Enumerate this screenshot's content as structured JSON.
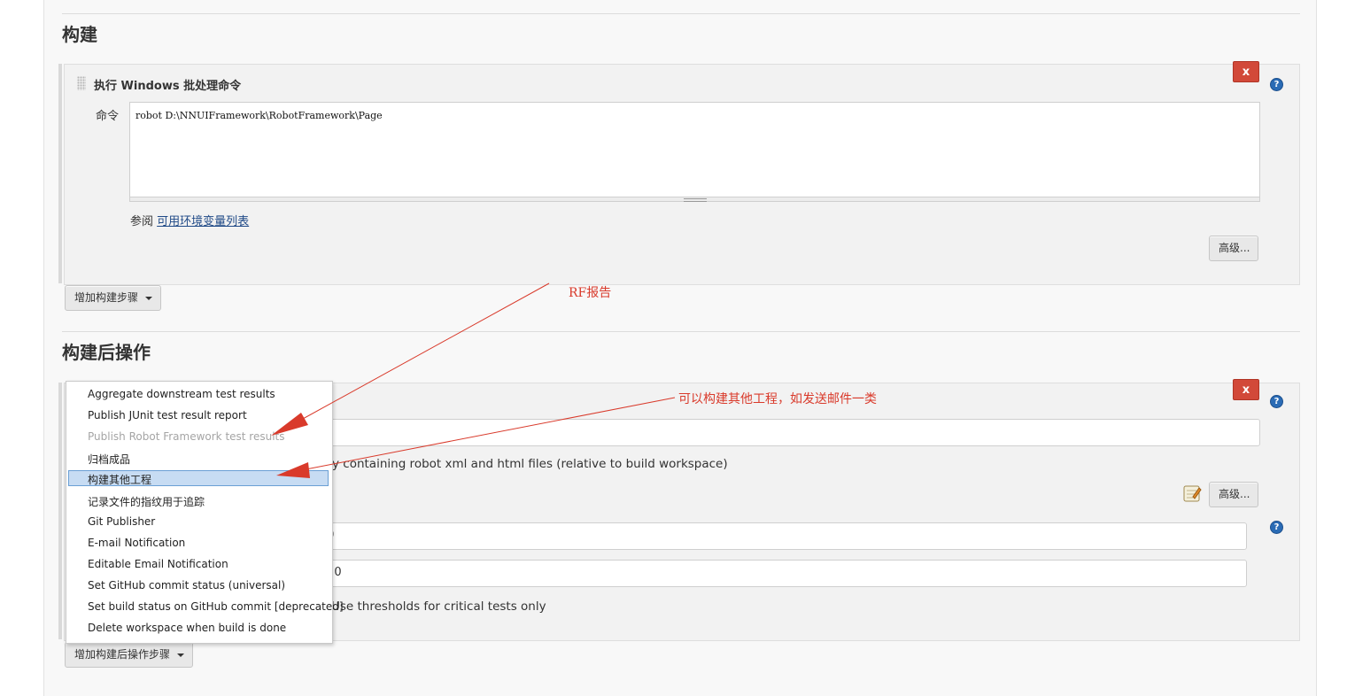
{
  "build": {
    "title": "构建",
    "step_title": "执行 Windows 批处理命令",
    "delete_label": "x",
    "command_label": "命令",
    "command_value": "robot D:\\NNUIFramework\\RobotFramework\\Page",
    "see_label": "参阅",
    "env_link": "可用环境变量列表",
    "advanced_label": "高级...",
    "add_step_label": "增加构建步骤"
  },
  "post_build": {
    "title": "构建后操作",
    "delete_label": "x",
    "dir_hint": "y containing robot xml and html files (relative to build workspace)",
    "advanced_label": "高级...",
    "threshold_1": ".0",
    "threshold_2": "0.0",
    "critical_label": "Use thresholds for critical tests only",
    "add_step_label": "增加构建后操作步骤"
  },
  "dropdown": {
    "items": [
      {
        "label": "Aggregate downstream test results",
        "state": "normal"
      },
      {
        "label": "Publish JUnit test result report",
        "state": "normal"
      },
      {
        "label": "Publish Robot Framework test results",
        "state": "disabled"
      },
      {
        "label": "归档成品",
        "state": "normal"
      },
      {
        "label": "构建其他工程",
        "state": "highlighted"
      },
      {
        "label": "记录文件的指纹用于追踪",
        "state": "normal"
      },
      {
        "label": "Git Publisher",
        "state": "normal"
      },
      {
        "label": "E-mail Notification",
        "state": "normal"
      },
      {
        "label": "Editable Email Notification",
        "state": "normal"
      },
      {
        "label": "Set GitHub commit status (universal)",
        "state": "normal"
      },
      {
        "label": "Set build status on GitHub commit [deprecated]",
        "state": "normal"
      },
      {
        "label": "Delete workspace when build is done",
        "state": "normal"
      }
    ]
  },
  "annotations": {
    "rf_report": "RF报告",
    "other_project": "可以构建其他工程，如发送邮件一类"
  },
  "icons": {
    "help": "?",
    "annotation_color": "#d93a2b",
    "delete_color": "#d24939",
    "highlight_color": "#c7dcf3"
  }
}
